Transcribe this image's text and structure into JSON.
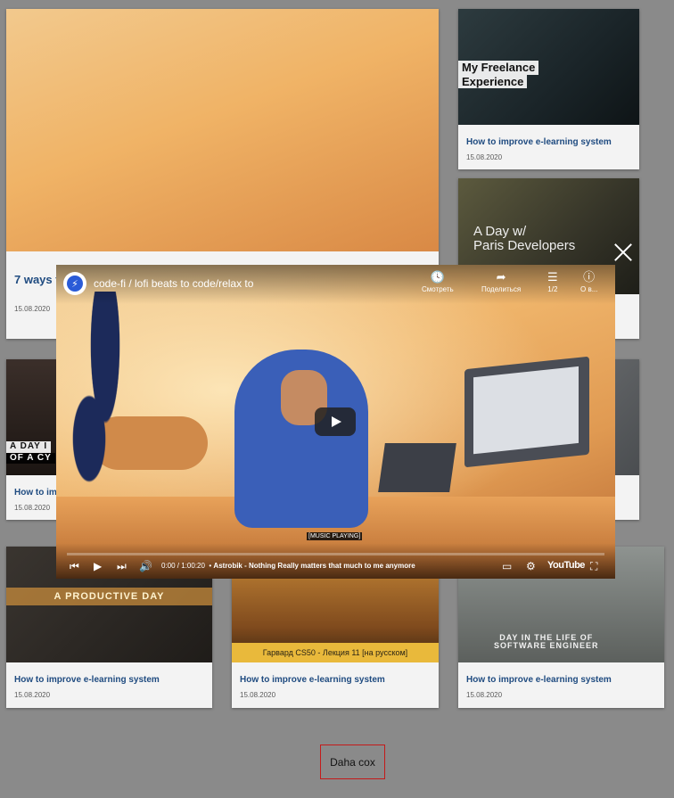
{
  "cards": [
    {
      "title": "7 ways t",
      "date": "15.08.2020"
    },
    {
      "title": "How to improve e-learning system",
      "date": "15.08.2020",
      "thumb_text": [
        "My Freelance",
        "Experience"
      ]
    },
    {
      "title": "",
      "date": "",
      "thumb_text": [
        "A Day w/",
        "Paris Developers"
      ]
    },
    {
      "title": "How to im",
      "date": "15.08.2020",
      "thumb_text": [
        "A DAY I",
        "OF A CY"
      ]
    },
    {
      "title": "",
      "date": ""
    },
    {
      "title": "How to improve e-learning system",
      "date": "15.08.2020",
      "thumb_text": [
        "A PRODUCTIVE DAY"
      ]
    },
    {
      "title": "How to improve e-learning system",
      "date": "15.08.2020",
      "thumb_text": [
        "Гарвард CS50 - Лекция 11 [на русском]"
      ]
    },
    {
      "title": "How to improve e-learning system",
      "date": "15.08.2020",
      "thumb_text": [
        "DAY IN THE LIFE OF",
        "SOFTWARE ENGINEER"
      ]
    }
  ],
  "player": {
    "channel_icon": "lightning-icon",
    "title": "code-fi / lofi beats to code/relax to",
    "actions": [
      {
        "icon": "clock-icon",
        "label": "Смотреть"
      },
      {
        "icon": "share-icon",
        "label": "Поделиться"
      },
      {
        "icon": "playlist-icon",
        "label": "1/2"
      },
      {
        "icon": "info-icon",
        "label": "О в..."
      }
    ],
    "caption": "[MUSIC PLAYING]",
    "time_current": "0:00",
    "time_total": "1:00:20",
    "now_playing": "Astrobik - Nothing Really matters that much to me anymore",
    "brand": "YouTube"
  },
  "more_button": "Daha cox"
}
